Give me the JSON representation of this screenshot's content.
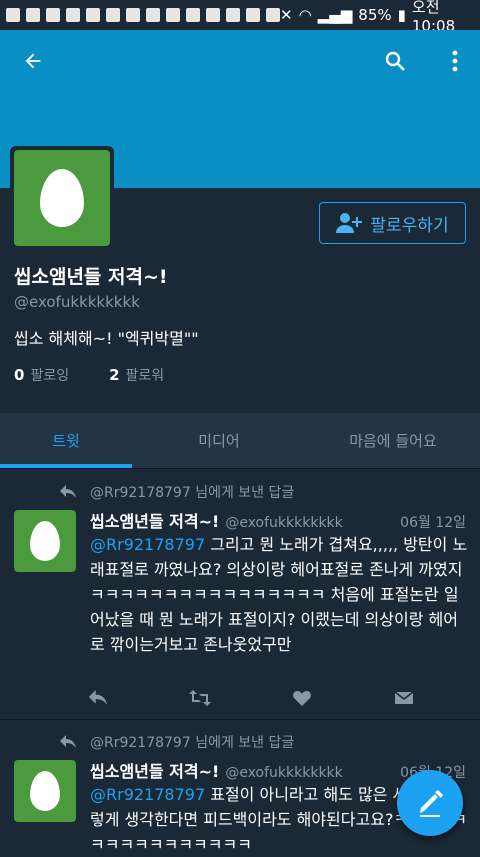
{
  "status_bar": {
    "battery": "85%",
    "time": "오전 10:08"
  },
  "profile": {
    "follow_label": "팔로우하기",
    "name": "씹소앰년들 저격~!",
    "handle": "@exofukkkkkkkk",
    "bio": "씹소 해체해~! \"엑퀴박멸\"\"",
    "following_count": "0",
    "following_label": "팔로잉",
    "followers_count": "2",
    "followers_label": "팔로워"
  },
  "tabs": [
    {
      "label": "트윗"
    },
    {
      "label": "미디어"
    },
    {
      "label": "마음에 들어요"
    }
  ],
  "tweets": [
    {
      "reply_to": "@Rr92178797 님에게 보낸 답글",
      "name": "씹소앰년들 저격~!",
      "handle": "@exofukkkkkkkk",
      "date": "06월 12일",
      "mention": "@Rr92178797",
      "text": " 그리고 뭔 노래가 겹쳐요,,,,, 방탄이 노래표절로 까였나요? 의상이랑 헤어표절로 존나게 까였지ㅋㅋㅋㅋㅋㅋㅋㅋㅋㅋㅋㅋㅋㅋㅋㅋ 처음에 표절논란 일어났을 때 뭔 노래가 표절이지? 이랬는데 의상이랑 헤어로 깎이는거보고 존나웃었구만"
    },
    {
      "reply_to": "@Rr92178797 님에게 보낸 답글",
      "name": "씹소앰년들 저격~!",
      "handle": "@exofukkkkkkkk",
      "date": "06월 12일",
      "mention": "@Rr92178797",
      "text": " 표절이 아니라고 해도 많은 사람이 그렇게 생각한다면 피드백이라도 해야된다고요?ㅋㅋㅋㅋㅋㅋㅋㅋㅋㅋㅋㅋㅋㅋㅋㅋ"
    }
  ],
  "colors": {
    "banner": "#0a8fc4",
    "background": "#1b2836",
    "accent": "#1da1f2",
    "avatar": "#4c9a3e"
  }
}
